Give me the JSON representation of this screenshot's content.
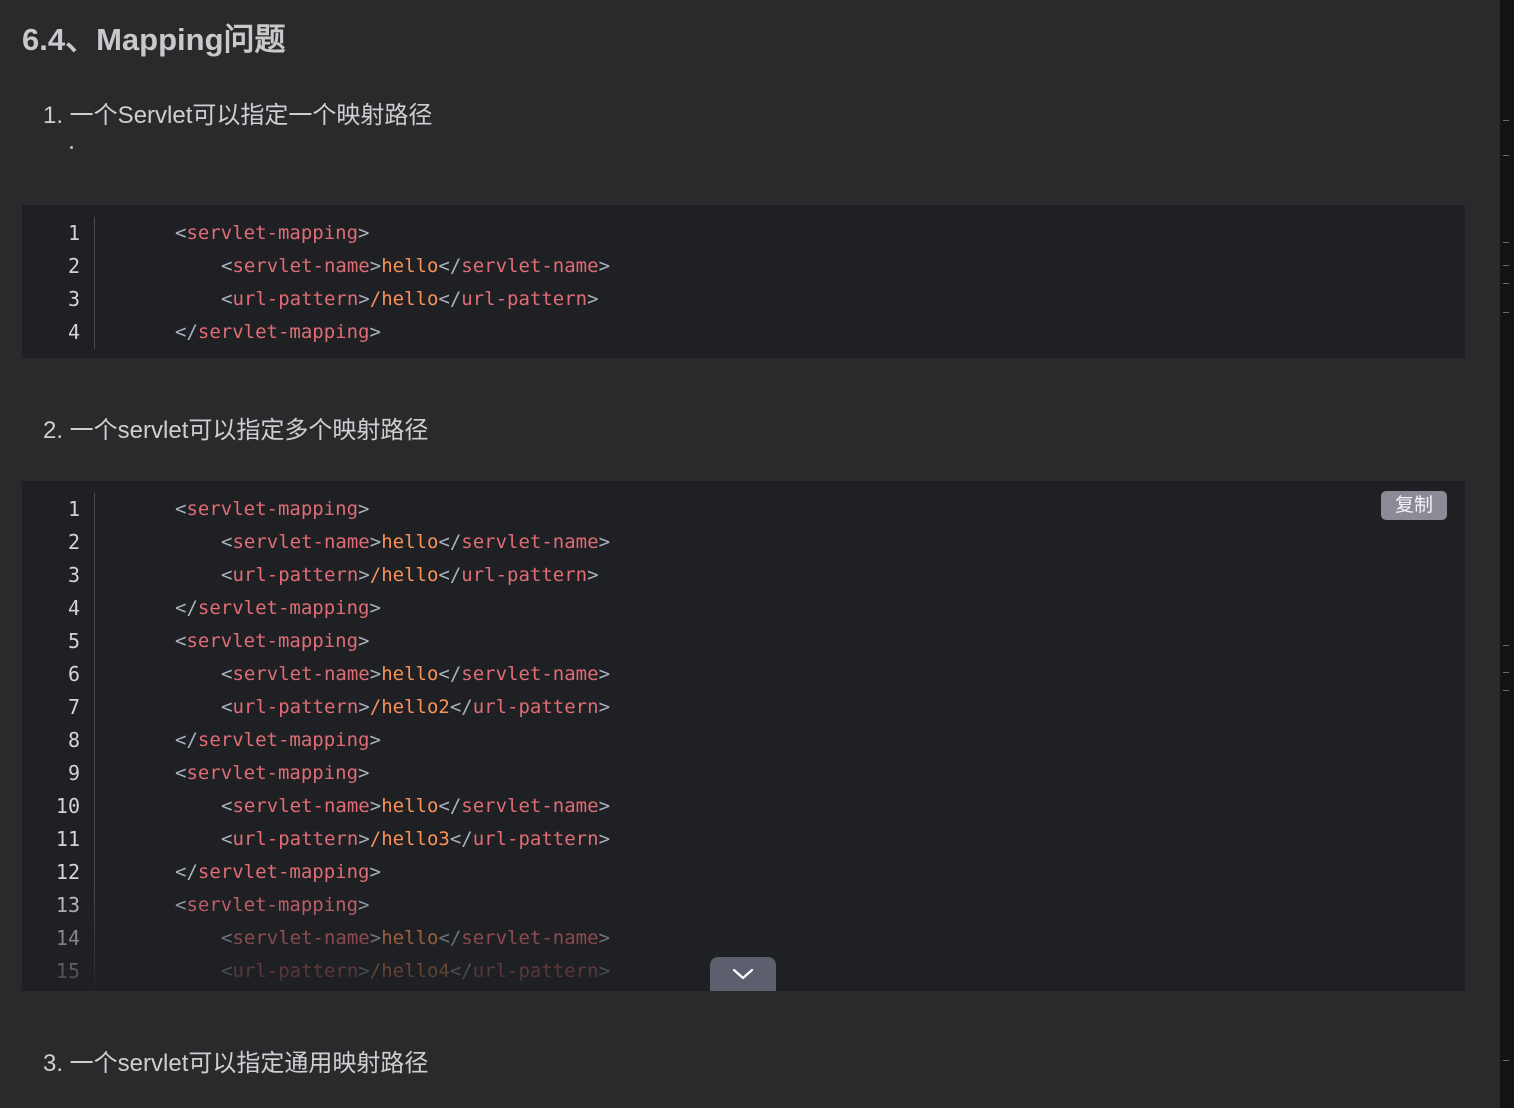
{
  "heading": "6.4、Mapping问题",
  "items": [
    {
      "label": "1. 一个Servlet可以指定一个映射路径"
    },
    {
      "label": "2. 一个servlet可以指定多个映射路径"
    },
    {
      "label": "3. 一个servlet可以指定通用映射路径"
    }
  ],
  "block1": {
    "lines": [
      {
        "num": "1",
        "tag1": "servlet-mapping"
      },
      {
        "num": "2",
        "tag1": "servlet-name",
        "value": "hello",
        "tag2": "servlet-name"
      },
      {
        "num": "3",
        "tag1": "url-pattern",
        "value": "/hello",
        "tag2": "url-pattern"
      },
      {
        "num": "4",
        "tag1": "servlet-mapping"
      }
    ]
  },
  "block2": {
    "copy_label": "复制",
    "expand_icon": "chevron-down-icon",
    "lines": [
      {
        "num": "1",
        "tag1": "servlet-mapping"
      },
      {
        "num": "2",
        "tag1": "servlet-name",
        "value": "hello",
        "tag2": "servlet-name"
      },
      {
        "num": "3",
        "tag1": "url-pattern",
        "value": "/hello",
        "tag2": "url-pattern"
      },
      {
        "num": "4",
        "tag1": "servlet-mapping"
      },
      {
        "num": "5",
        "tag1": "servlet-mapping"
      },
      {
        "num": "6",
        "tag1": "servlet-name",
        "value": "hello",
        "tag2": "servlet-name"
      },
      {
        "num": "7",
        "tag1": "url-pattern",
        "value": "/hello2",
        "tag2": "url-pattern"
      },
      {
        "num": "8",
        "tag1": "servlet-mapping"
      },
      {
        "num": "9",
        "tag1": "servlet-mapping"
      },
      {
        "num": "10",
        "tag1": "servlet-name",
        "value": "hello",
        "tag2": "servlet-name"
      },
      {
        "num": "11",
        "tag1": "url-pattern",
        "value": "/hello3",
        "tag2": "url-pattern"
      },
      {
        "num": "12",
        "tag1": "servlet-mapping"
      },
      {
        "num": "13",
        "tag1": "servlet-mapping"
      },
      {
        "num": "14",
        "tag1": "servlet-name",
        "value": "hello",
        "tag2": "servlet-name"
      },
      {
        "num": "15",
        "tag1": "url-pattern",
        "value": "/hello4",
        "tag2": "url-pattern"
      }
    ]
  },
  "colors": {
    "background": "#2a2a2d",
    "code_background": "#1f2023",
    "tag": "#e06c75",
    "value": "#f99157",
    "punctuation": "#abb2bf",
    "copy_button": "#8b8b96",
    "expand_button": "#5b5f6e"
  }
}
